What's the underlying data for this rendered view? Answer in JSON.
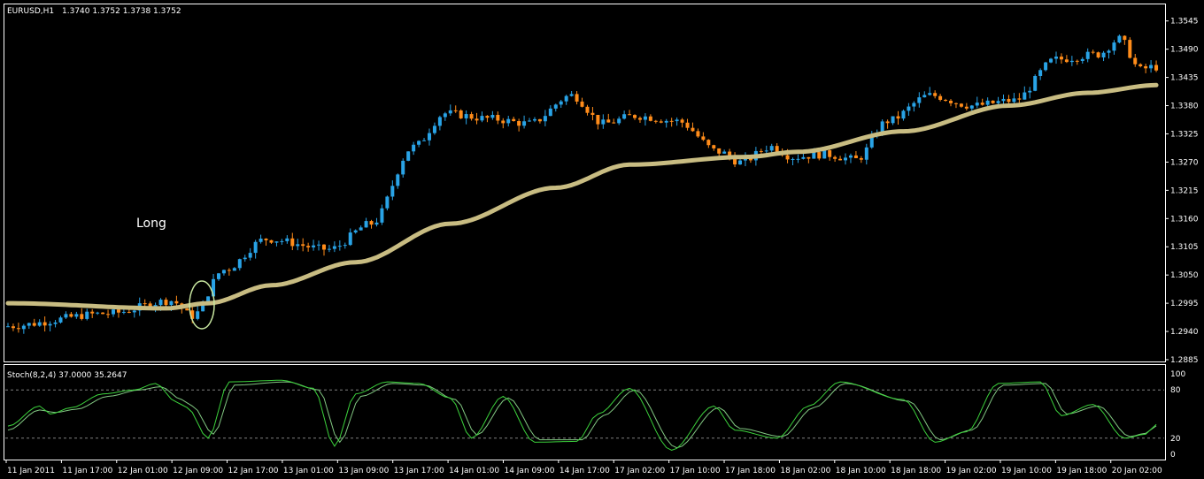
{
  "header": {
    "symbol": "EURUSD,H1",
    "ohlc": "1.3740 1.3752 1.3738 1.3752"
  },
  "annotation": {
    "label": "Long"
  },
  "colors": {
    "background": "#000000",
    "frame": "#ffffff",
    "bull": "#29a3e6",
    "bear": "#ff8c1a",
    "ma": "#c8bc82",
    "stoch_main": "#3cd23c",
    "stoch_signal": "#82c882",
    "level_line": "#808080",
    "signal_ellipse": "#c8e6a0"
  },
  "indicator_panel": {
    "label": "Stoch(8,2,4) 37.0000 35.2647",
    "levels": [
      80,
      20
    ],
    "tick_labels": [
      "100",
      "80",
      "20",
      "0"
    ]
  },
  "chart_data": [
    {
      "type": "candlestick",
      "title": "EURUSD,H1",
      "y_ticks": [
        "1.3545",
        "1.3490",
        "1.3435",
        "1.3380",
        "1.3325",
        "1.3270",
        "1.3215",
        "1.3160",
        "1.3105",
        "1.3050",
        "1.2995",
        "1.2940",
        "1.2885"
      ],
      "ylim": [
        1.2885,
        1.356
      ],
      "x_labels": [
        "11 Jan 2011",
        "11 Jan 17:00",
        "12 Jan 01:00",
        "12 Jan 09:00",
        "12 Jan 17:00",
        "13 Jan 01:00",
        "13 Jan 09:00",
        "13 Jan 17:00",
        "14 Jan 01:00",
        "14 Jan 09:00",
        "14 Jan 17:00",
        "17 Jan 02:00",
        "17 Jan 10:00",
        "17 Jan 18:00",
        "18 Jan 02:00",
        "18 Jan 10:00",
        "18 Jan 18:00",
        "19 Jan 02:00",
        "19 Jan 10:00",
        "19 Jan 18:00",
        "20 Jan 02:00"
      ],
      "ma_start": 1.2995,
      "ma_waypoints": [
        [
          0,
          1.2995
        ],
        [
          30,
          1.2985
        ],
        [
          38,
          1.2995
        ],
        [
          50,
          1.303
        ],
        [
          66,
          1.3075
        ],
        [
          84,
          1.315
        ],
        [
          104,
          1.322
        ],
        [
          118,
          1.3265
        ],
        [
          140,
          1.328
        ],
        [
          150,
          1.329
        ],
        [
          170,
          1.333
        ],
        [
          190,
          1.338
        ],
        [
          205,
          1.3405
        ],
        [
          218,
          1.342
        ]
      ],
      "signal_marker": {
        "text": "Long",
        "bar": 37
      },
      "candle_count": 219
    },
    {
      "type": "line",
      "title": "Stoch(8,2,4) 37.0000 35.2647",
      "ylim": [
        0,
        100
      ],
      "levels": [
        20,
        80
      ],
      "series": [
        {
          "name": "Main",
          "waypoints": [
            [
              0,
              35
            ],
            [
              6,
              60
            ],
            [
              8,
              50
            ],
            [
              12,
              58
            ],
            [
              18,
              75
            ],
            [
              24,
              80
            ],
            [
              28,
              88
            ],
            [
              32,
              65
            ],
            [
              34,
              58
            ],
            [
              38,
              20
            ],
            [
              42,
              90
            ],
            [
              52,
              92
            ],
            [
              58,
              82
            ],
            [
              62,
              10
            ],
            [
              66,
              75
            ],
            [
              72,
              90
            ],
            [
              78,
              88
            ],
            [
              84,
              70
            ],
            [
              88,
              20
            ],
            [
              94,
              72
            ],
            [
              100,
              15
            ],
            [
              108,
              16
            ],
            [
              112,
              50
            ],
            [
              118,
              82
            ],
            [
              126,
              5
            ],
            [
              134,
              60
            ],
            [
              138,
              30
            ],
            [
              146,
              20
            ],
            [
              152,
              60
            ],
            [
              158,
              90
            ],
            [
              170,
              68
            ],
            [
              176,
              15
            ],
            [
              182,
              28
            ],
            [
              188,
              88
            ],
            [
              196,
              90
            ],
            [
              200,
              48
            ],
            [
              206,
              62
            ],
            [
              212,
              20
            ],
            [
              216,
              25
            ],
            [
              218,
              37
            ]
          ]
        },
        {
          "name": "Signal",
          "waypoints": [
            [
              0,
              30
            ],
            [
              6,
              55
            ],
            [
              9,
              52
            ],
            [
              13,
              56
            ],
            [
              19,
              72
            ],
            [
              25,
              80
            ],
            [
              29,
              84
            ],
            [
              33,
              68
            ],
            [
              35,
              60
            ],
            [
              39,
              25
            ],
            [
              43,
              86
            ],
            [
              53,
              90
            ],
            [
              59,
              80
            ],
            [
              63,
              15
            ],
            [
              67,
              72
            ],
            [
              73,
              88
            ],
            [
              79,
              86
            ],
            [
              85,
              68
            ],
            [
              89,
              24
            ],
            [
              95,
              70
            ],
            [
              101,
              18
            ],
            [
              109,
              18
            ],
            [
              113,
              48
            ],
            [
              119,
              80
            ],
            [
              127,
              8
            ],
            [
              135,
              58
            ],
            [
              139,
              32
            ],
            [
              147,
              22
            ],
            [
              153,
              58
            ],
            [
              159,
              88
            ],
            [
              171,
              66
            ],
            [
              177,
              18
            ],
            [
              183,
              30
            ],
            [
              189,
              86
            ],
            [
              197,
              88
            ],
            [
              201,
              50
            ],
            [
              207,
              60
            ],
            [
              213,
              22
            ],
            [
              216,
              26
            ],
            [
              218,
              35.26
            ]
          ]
        }
      ]
    }
  ]
}
